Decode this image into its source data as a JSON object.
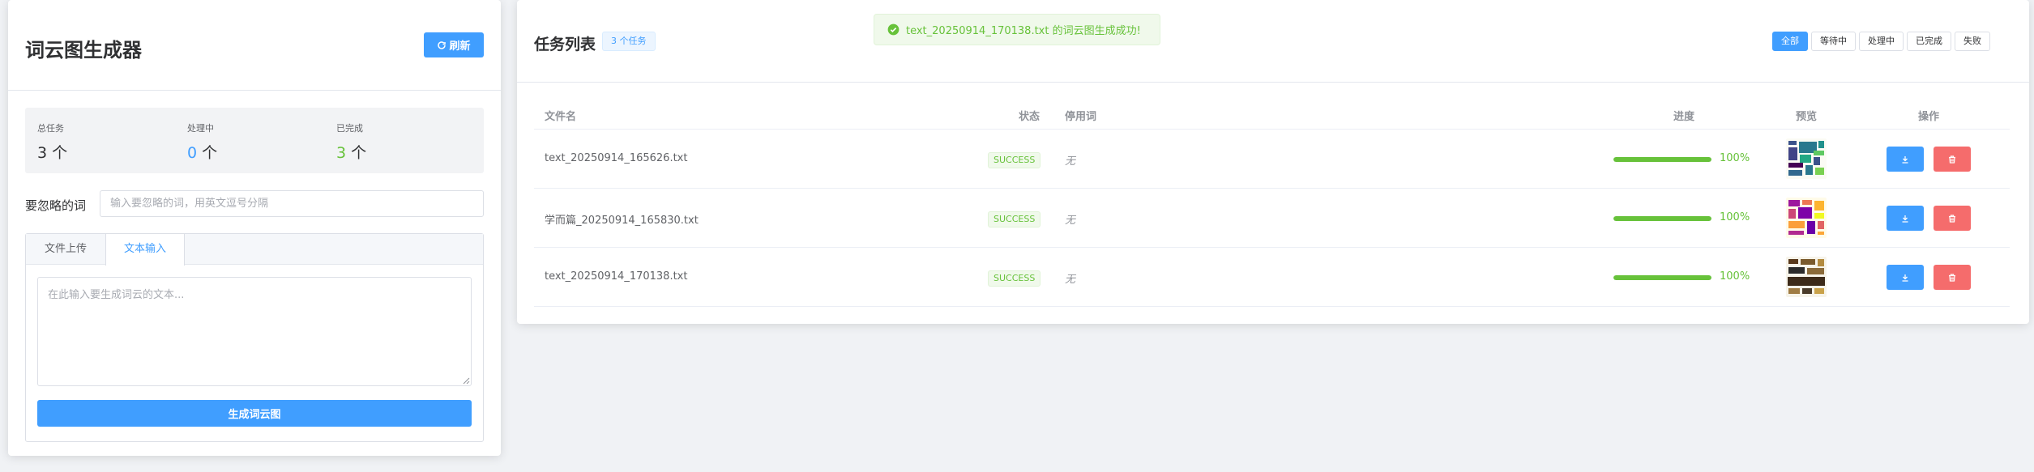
{
  "app": {
    "title": "词云图生成器",
    "refresh_label": "刷新"
  },
  "stats": [
    {
      "label": "总任务",
      "value": "3",
      "unit": "个"
    },
    {
      "label": "处理中",
      "value": "0",
      "unit": "个"
    },
    {
      "label": "已完成",
      "value": "3",
      "unit": "个"
    }
  ],
  "ignore": {
    "label": "要忽略的词",
    "placeholder": "输入要忽略的词，用英文逗号分隔"
  },
  "input_tabs": [
    {
      "label": "文件上传",
      "active": false
    },
    {
      "label": "文本输入",
      "active": true
    }
  ],
  "text_input": {
    "placeholder": "在此输入要生成词云的文本..."
  },
  "generate_label": "生成词云图",
  "toast": {
    "message": "text_20250914_170138.txt 的词云图生成成功!"
  },
  "task_list": {
    "title": "任务列表",
    "count_badge": "3 个任务",
    "filters": [
      {
        "label": "全部",
        "active": true
      },
      {
        "label": "等待中",
        "active": false
      },
      {
        "label": "处理中",
        "active": false
      },
      {
        "label": "已完成",
        "active": false
      },
      {
        "label": "失败",
        "active": false
      }
    ],
    "columns": [
      "文件名",
      "状态",
      "停用词",
      "进度",
      "预览",
      "操作"
    ],
    "rows": [
      {
        "filename": "text_20250914_165626.txt",
        "status": "SUCCESS",
        "stopwords": "无",
        "progress": 100,
        "progress_text": "100%"
      },
      {
        "filename": "学而篇_20250914_165830.txt",
        "status": "SUCCESS",
        "stopwords": "无",
        "progress": 100,
        "progress_text": "100%"
      },
      {
        "filename": "text_20250914_170138.txt",
        "status": "SUCCESS",
        "stopwords": "无",
        "progress": 100,
        "progress_text": "100%"
      }
    ]
  },
  "colors": {
    "primary": "#409eff",
    "success": "#67c23a",
    "danger": "#f56c6c"
  },
  "icons": {
    "refresh": "refresh-icon",
    "download": "download-icon",
    "delete": "trash-icon",
    "toast": "check-circle-icon"
  }
}
